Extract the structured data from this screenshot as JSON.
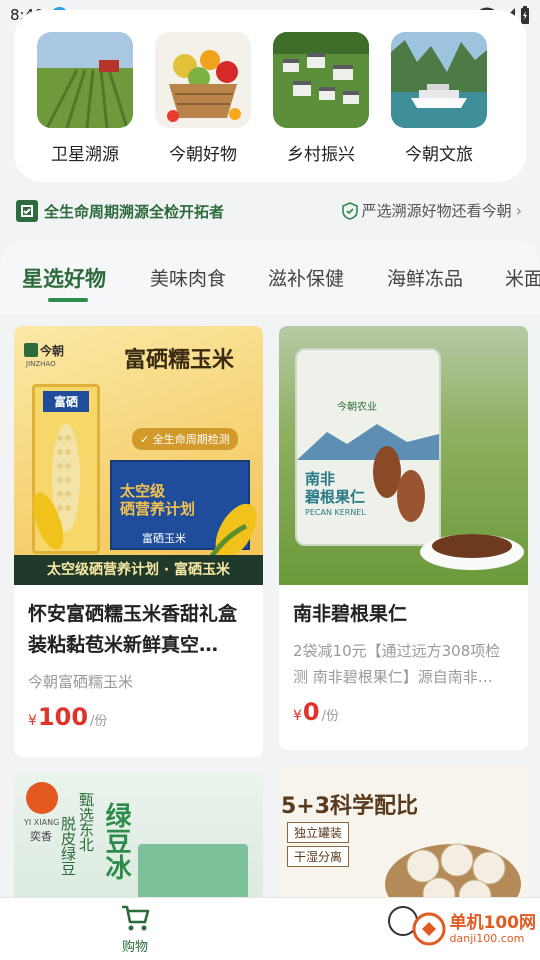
{
  "status": {
    "time": "8:40"
  },
  "features": [
    {
      "label": "卫星溯源",
      "icon": "satellite-farm-image"
    },
    {
      "label": "今朝好物",
      "icon": "fruit-basket-image"
    },
    {
      "label": "乡村振兴",
      "icon": "village-image"
    },
    {
      "label": "今朝文旅",
      "icon": "river-boat-image"
    }
  ],
  "slogan": {
    "left": "全生命周期溯源全检开拓者",
    "right": "严选溯源好物还看今朝"
  },
  "categories": [
    "星选好物",
    "美味肉食",
    "滋补保健",
    "海鲜冻品",
    "米面"
  ],
  "products": [
    {
      "image_texts": {
        "brand": "今朝",
        "brand_sub": "JINZHAO",
        "headline": "富硒糯玉米",
        "badge": "全生命周期检测",
        "box_line1": "太空级",
        "box_line2": "硒营养计划",
        "box_foot": "富硒玉米",
        "bag_text": "富硒",
        "banner": "太空级硒营养计划 · 富硒玉米"
      },
      "title": "怀安富硒糯玉米香甜礼盒装粘黏苞米新鲜真空…",
      "desc": "今朝富硒糯玉米",
      "price": "100",
      "currency": "¥",
      "unit": "/份"
    },
    {
      "image_texts": {
        "brand": "今朝农业",
        "pack_line1": "南非",
        "pack_line2": "碧根果仁",
        "pack_en": "PECAN KERNEL"
      },
      "title": "南非碧根果仁",
      "desc": "2袋减10元【通过远方308项检测 南非碧根果仁】源自南非…",
      "price": "0",
      "currency": "¥",
      "unit": "/份"
    },
    {
      "image_texts": {
        "brand": "奕香",
        "brand_en": "YI XIANG",
        "line1": "甄选东北",
        "line2": "脱皮绿豆",
        "big": "绿豆冰"
      }
    },
    {
      "image_texts": {
        "headline": "5+3科学配比",
        "tag1": "独立罐装",
        "tag2": "干湿分离"
      }
    }
  ],
  "tabbar": {
    "shop_label": "购物"
  },
  "watermark": {
    "line1": "单机100网",
    "line2": "danji100.com"
  },
  "colors": {
    "brand_green": "#2d6b3c",
    "price_red": "#e0332a",
    "accent_green": "#2d8c4a"
  }
}
